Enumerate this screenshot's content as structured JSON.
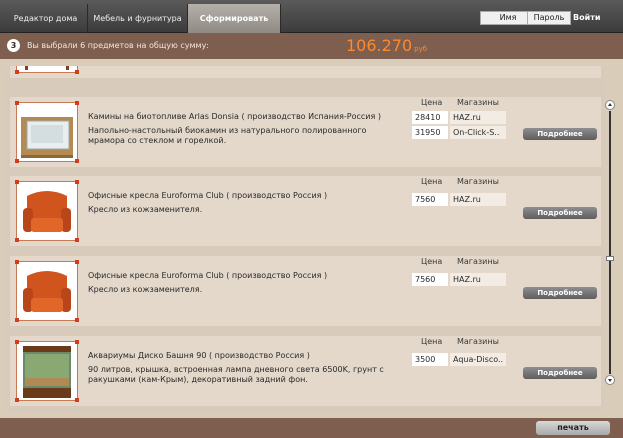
{
  "nav": {
    "tabs": [
      {
        "label": "Редактор дома"
      },
      {
        "label": "Мебель и фурнитура"
      },
      {
        "label": "Сформировать отчет"
      }
    ],
    "username_field": "Имя",
    "password_field": "Пароль",
    "login": "Войти"
  },
  "summary": {
    "step": "3",
    "text": "Вы выбрали 6 предметов на общую сумму:",
    "total": "106.270",
    "currency": "руб"
  },
  "columns": {
    "price": "Цена",
    "shops": "Магазины"
  },
  "items": [
    {
      "title": "Камины на биотопливе Arlas Donsia ( производство Испания-Россия )",
      "description": "Напольно-настольный биокамин из натурального полированного мрамора со стеклом и горелкой.",
      "offers": [
        {
          "price": "28410",
          "shop": "HAZ.ru"
        },
        {
          "price": "31950",
          "shop": "On-Click-S.."
        }
      ],
      "button": "Подробнее"
    },
    {
      "title": "Офисные кресла Euroforma Club ( производство Россия )",
      "description": "Кресло из кожзаменителя.",
      "offers": [
        {
          "price": "7560",
          "shop": "HAZ.ru"
        }
      ],
      "button": "Подробнее"
    },
    {
      "title": "Офисные кресла Euroforma Club ( производство Россия )",
      "description": "Кресло из кожзаменителя.",
      "offers": [
        {
          "price": "7560",
          "shop": "HAZ.ru"
        }
      ],
      "button": "Подробнее"
    },
    {
      "title": "Аквариумы Диско Башня 90 ( производство Россия )",
      "description": "90 литров, крышка, встроенная лампа дневного света 6500K, грунт с ракушками (кам-Крым), декоративный задний фон.",
      "offers": [
        {
          "price": "3500",
          "shop": "Aqua-Disco.."
        }
      ],
      "button": "Подробнее"
    }
  ],
  "print": "печать",
  "colors": {
    "accent": "#ff8a2c",
    "summary_bar": "#7d5e4f",
    "panel": "#d8cbbb"
  }
}
